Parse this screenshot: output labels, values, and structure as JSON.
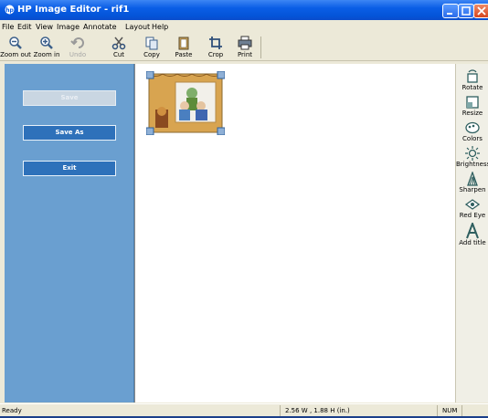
{
  "window": {
    "title": "HP Image Editor - rif1",
    "icon": "hp-icon"
  },
  "menu": [
    "File",
    "Edit",
    "View",
    "Image",
    "Annotate",
    "Layout",
    "Help"
  ],
  "toolbar": {
    "zoom_out": "Zoom out",
    "zoom_in": "Zoom in",
    "undo": "Undo",
    "cut": "Cut",
    "copy": "Copy",
    "paste": "Paste",
    "crop": "Crop",
    "print": "Print"
  },
  "left_panel": {
    "save": "Save",
    "save_as": "Save As",
    "exit": "Exit"
  },
  "right_panel": {
    "rotate": "Rotate",
    "resize": "Resize",
    "colors": "Colors",
    "brightness": "Brightness",
    "sharpen": "Sharpen",
    "red_eye": "Red Eye",
    "add_title": "Add title"
  },
  "status": {
    "text": "Ready",
    "dimensions": "2.56 W , 1.88 H (in.)",
    "num": "NUM"
  },
  "colors": {
    "title_bar": "#0454d8",
    "left_panel": "#6a9fd0",
    "panel_button": "#2e71ba",
    "chrome": "#ece9d8"
  }
}
